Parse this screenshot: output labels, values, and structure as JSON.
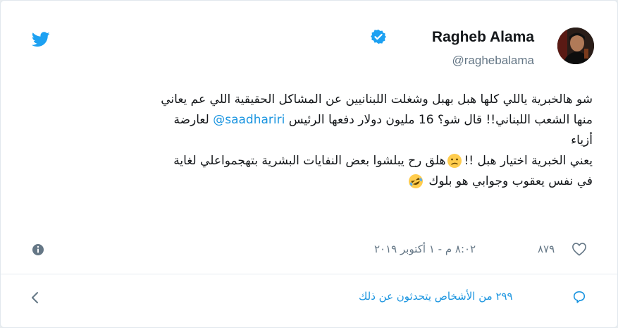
{
  "author": {
    "display_name": "Ragheb Alama",
    "handle": "@raghebalama",
    "verified": true
  },
  "tweet": {
    "line1": "شو هالخبرية ياللي كلها هبل بهبل  وشغلت اللبنانيين عن المشاكل الحقيقية اللي عم يعاني",
    "line2_before_mention": "منها الشعب اللبناني!! قال شو؟ 16 مليون دولار دفعها الرئيس ",
    "line2_mention": "@saadhariri",
    "line2_after_mention": " لعارضة",
    "line3": "أزياء",
    "line4_before_emoji": "يعني الخبرية اختيار هبل !!",
    "line4_after_emoji": "هلق رح يبلشوا بعض النفايات البشرية بتهجمواعلي لغاية",
    "line5": "في نفس يعقوب وجوابي هو  بلوك",
    "emoji_1": "confused-face",
    "emoji_2": "rolling-on-floor-laughing"
  },
  "meta": {
    "timestamp": "٨:٠٢ م - ١ أكتوبر ٢٠١٩",
    "likes": "٨٧٩"
  },
  "footer": {
    "replies_text": "٢٩٩ من الأشخاص يتحدثون عن ذلك"
  },
  "colors": {
    "brand": "#1da1f2",
    "link": "#1b95e0",
    "text": "#14171a",
    "muted": "#657786"
  }
}
